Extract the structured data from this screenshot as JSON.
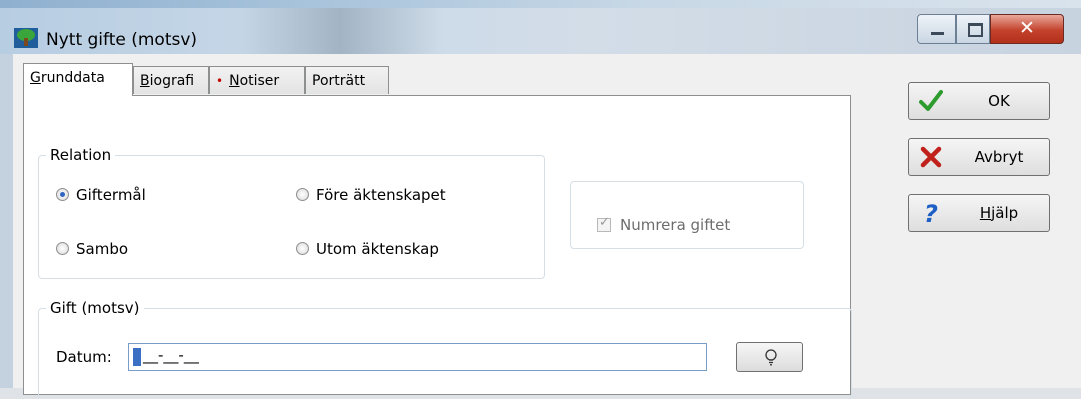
{
  "window": {
    "title": "Nytt gifte (motsv)",
    "close_glyph": "✕"
  },
  "tabs": [
    {
      "label": "Grunddata",
      "mnemonic": "G",
      "active": true
    },
    {
      "label": "Biografi",
      "mnemonic": "B",
      "active": false
    },
    {
      "label": "Notiser",
      "mnemonic": "N",
      "active": false,
      "marker": "•"
    },
    {
      "label": "Porträtt",
      "mnemonic": "t",
      "active": false
    }
  ],
  "relation": {
    "title": "Relation",
    "options": [
      {
        "label": "Giftermål",
        "selected": true
      },
      {
        "label": "Före äktenskapet",
        "selected": false
      },
      {
        "label": "Sambo",
        "selected": false
      },
      {
        "label": "Utom äktenskap",
        "selected": false
      }
    ]
  },
  "numrera": {
    "label": "Numrera giftet",
    "checked": true,
    "enabled": false
  },
  "gift": {
    "title": "Gift (motsv)",
    "date_label": "Datum:",
    "date_mask": "__-__-__"
  },
  "buttons": {
    "ok": "OK",
    "cancel": "Avbryt",
    "help": "Hjälp"
  },
  "icons": {
    "app": "tree-icon",
    "ok": "green-checkmark-icon",
    "cancel": "red-x-icon",
    "help": "blue-question-icon",
    "suggest": "lightbulb-icon"
  },
  "colors": {
    "ok_check": "#2e9b2e",
    "cancel_x": "#c0221b",
    "help_q": "#1d5fc4",
    "notiser_dot": "#c00000"
  }
}
